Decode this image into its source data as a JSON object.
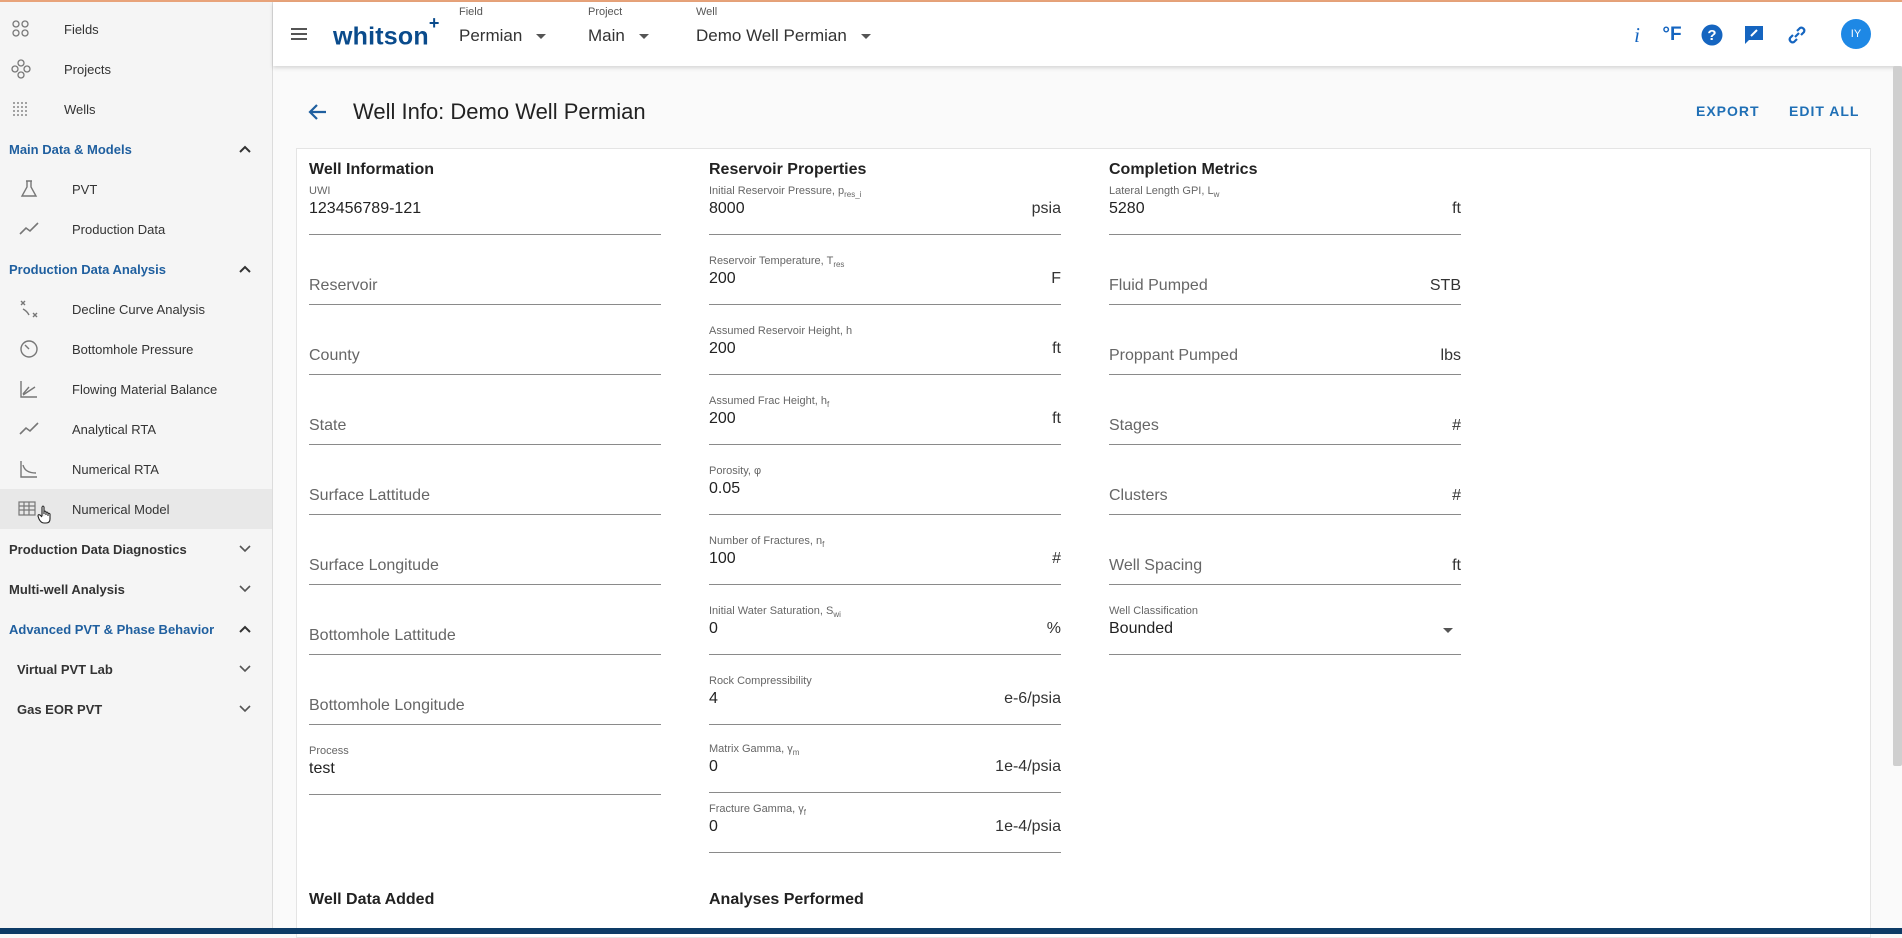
{
  "sidebar": {
    "top_items": [
      {
        "label": "Fields",
        "icon": "fields-icon"
      },
      {
        "label": "Projects",
        "icon": "projects-icon"
      },
      {
        "label": "Wells",
        "icon": "wells-icon"
      }
    ],
    "sections": [
      {
        "label": "Main Data & Models",
        "expanded": true,
        "items": [
          "PVT",
          "Production Data"
        ]
      },
      {
        "label": "Production Data Analysis",
        "expanded": true,
        "items": [
          "Decline Curve Analysis",
          "Bottomhole Pressure",
          "Flowing Material Balance",
          "Analytical RTA",
          "Numerical RTA",
          "Numerical Model"
        ]
      },
      {
        "label": "Production Data Diagnostics",
        "expanded": false
      },
      {
        "label": "Multi-well Analysis",
        "expanded": false
      },
      {
        "label": "Advanced PVT & Phase Behavior",
        "expanded": true,
        "subsections": [
          "Virtual PVT Lab",
          "Gas EOR PVT"
        ]
      }
    ]
  },
  "topbar": {
    "logo": "whitson",
    "logo_plus": "+",
    "field_caption": "Field",
    "field_value": "Permian",
    "project_caption": "Project",
    "project_value": "Main",
    "well_caption": "Well",
    "well_value": "Demo Well Permian",
    "info_icon_text": "i",
    "units_icon_text": "°F",
    "avatar_initials": "IY"
  },
  "page": {
    "title": "Well Info: Demo Well Permian",
    "export_label": "EXPORT",
    "edit_all_label": "EDIT ALL"
  },
  "well_information": {
    "title": "Well Information",
    "uwi_label": "UWI",
    "uwi_value": "123456789-121",
    "reservoir": "Reservoir",
    "county": "County",
    "state": "State",
    "surface_lat": "Surface Lattitude",
    "surface_lon": "Surface Longitude",
    "bh_lat": "Bottomhole Lattitude",
    "bh_lon": "Bottomhole Longitude",
    "process_label": "Process",
    "process_value": "test"
  },
  "reservoir_properties": {
    "title": "Reservoir Properties",
    "fields": [
      {
        "label": "Initial Reservoir Pressure, p",
        "sub": "res_i",
        "value": "8000",
        "unit": "psia"
      },
      {
        "label": "Reservoir Temperature, T",
        "sub": "res",
        "value": "200",
        "unit": "F"
      },
      {
        "label": "Assumed Reservoir Height, h",
        "sub": "",
        "value": "200",
        "unit": "ft"
      },
      {
        "label": "Assumed Frac Height, h",
        "sub": "f",
        "value": "200",
        "unit": "ft"
      },
      {
        "label": "Porosity, φ",
        "sub": "",
        "value": "0.05",
        "unit": ""
      },
      {
        "label": "Number of Fractures, n",
        "sub": "f",
        "value": "100",
        "unit": "#"
      },
      {
        "label": "Initial Water Saturation, S",
        "sub": "wi",
        "value": "0",
        "unit": "%"
      },
      {
        "label": "Rock Compressibility",
        "sub": "",
        "value": "4",
        "unit": "e-6/psia"
      },
      {
        "label": "Matrix Gamma, γ",
        "sub": "m",
        "value": "0",
        "unit": "1e-4/psia"
      },
      {
        "label": "Fracture Gamma, γ",
        "sub": "f",
        "value": "0",
        "unit": "1e-4/psia"
      }
    ]
  },
  "completion_metrics": {
    "title": "Completion Metrics",
    "lateral_label": "Lateral Length GPI, L",
    "lateral_sub": "w",
    "lateral_value": "5280",
    "lateral_unit": "ft",
    "fields": [
      {
        "label": "Fluid Pumped",
        "unit": "STB"
      },
      {
        "label": "Proppant Pumped",
        "unit": "lbs"
      },
      {
        "label": "Stages",
        "unit": "#"
      },
      {
        "label": "Clusters",
        "unit": "#"
      },
      {
        "label": "Well Spacing",
        "unit": "ft"
      }
    ],
    "classification_label": "Well Classification",
    "classification_value": "Bounded"
  },
  "bottom_sections": {
    "well_data_added": "Well Data Added",
    "analyses_performed": "Analyses Performed"
  }
}
